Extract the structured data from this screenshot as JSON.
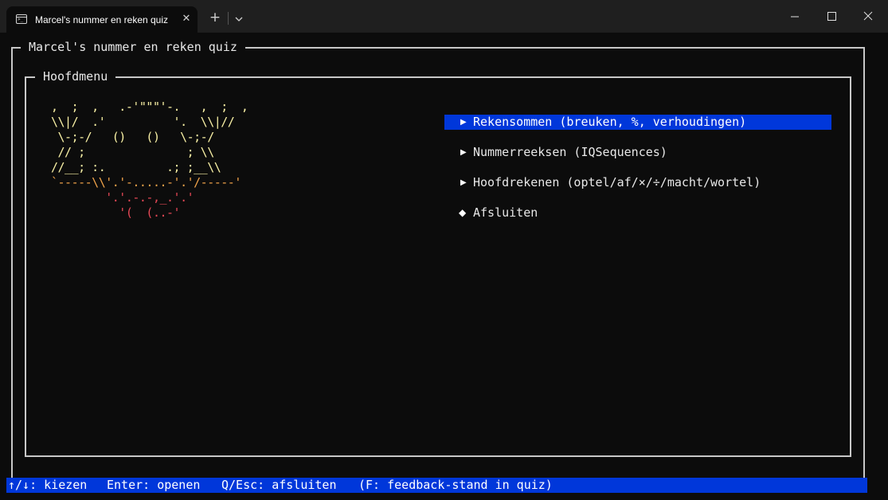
{
  "window": {
    "tab_title": "Marcel's nummer en reken quiz",
    "tab_icon": "terminal-icon",
    "buttons": {
      "close_tab": "close-icon",
      "new_tab": "plus-icon",
      "dropdown": "chevron-down-icon",
      "minimize": "minimize-icon",
      "maximize": "maximize-icon",
      "close_window": "close-icon"
    }
  },
  "app": {
    "title": "Marcel's nummer en reken quiz",
    "panel_title": "Hoofdmenu"
  },
  "ascii_art": [
    ",  ;  ,   .-'\"\"\"'-.   ,  ;  ,",
    "\\\\|/  .'          '.  \\\\|//",
    " \\-;-/   ()   ()   \\-;-/",
    " // ;               ; \\\\",
    "//__; :.         .; ;__\\\\",
    "`-----\\\\'.'-.....-'.'/-----'",
    "        '.'.-.-,_.'.'",
    "          '(  (..-'"
  ],
  "menu": {
    "items": [
      {
        "label": "Rekensommen (breuken, %, verhoudingen)",
        "marker": "▶",
        "selected": true
      },
      {
        "label": "Nummerreeksen (IQSequences)",
        "marker": "▶",
        "selected": false
      },
      {
        "label": "Hoofdrekenen (optel/af/×/÷/macht/wortel)",
        "marker": "▶",
        "selected": false
      },
      {
        "label": "Afsluiten",
        "marker": "◆",
        "selected": false
      }
    ]
  },
  "statusbar": {
    "hint_choose": "↑/↓: kiezen",
    "hint_open": "Enter: openen",
    "hint_quit": "Q/Esc: afsluiten",
    "hint_feedback": "(F: feedback-stand in quiz)"
  },
  "colors": {
    "terminal_bg": "#0c0c0c",
    "titlebar_bg": "#1f1f1f",
    "selection_bg": "#0037da",
    "border": "#c8c8c8",
    "ascii_yellow": "#f9f1a5",
    "ascii_red": "#e74856",
    "ascii_orange": "#f2a44a"
  }
}
